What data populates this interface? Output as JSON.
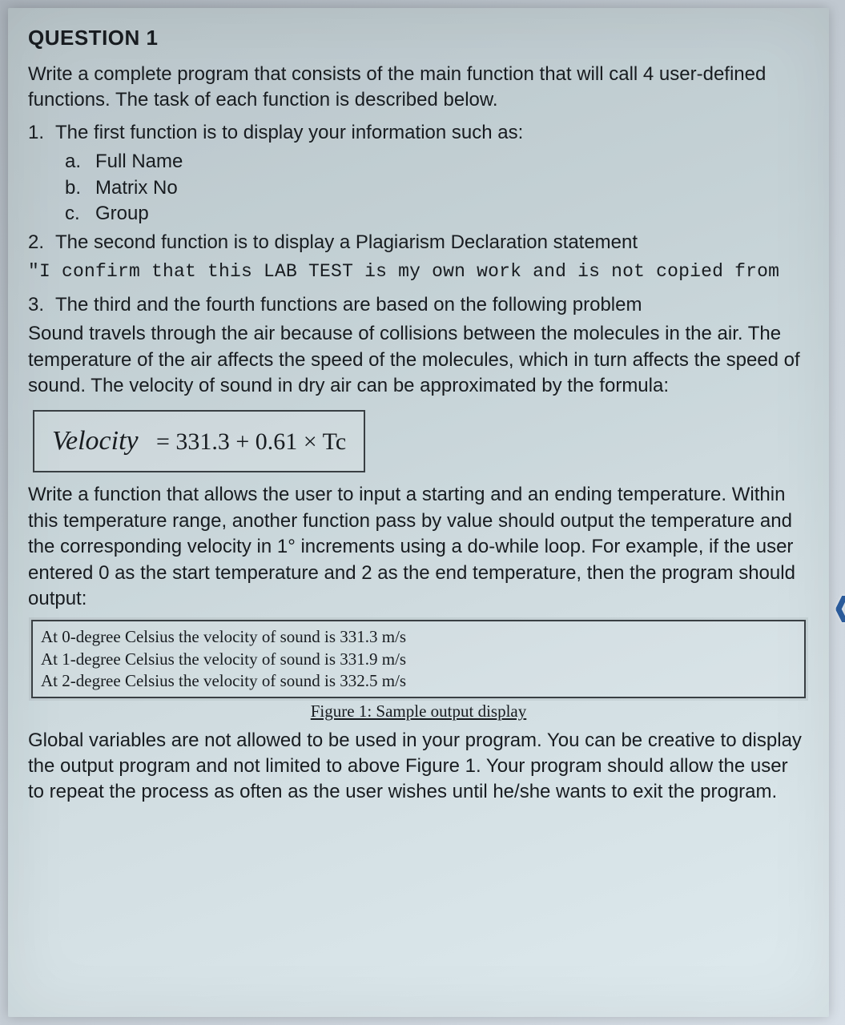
{
  "title": "QUESTION 1",
  "intro": "Write a complete program that consists of the main function that will call 4 user-defined functions. The task of each function is described below.",
  "item1": {
    "num": "1.",
    "text": "The first function is to display your information such as:",
    "a": {
      "label": "a.",
      "text": "Full Name"
    },
    "b": {
      "label": "b.",
      "text": "Matrix No"
    },
    "c": {
      "label": "c.",
      "text": "Group"
    }
  },
  "item2": {
    "num": "2.",
    "text": "The second function is to display a Plagiarism Declaration statement",
    "mono": "\"I confirm that this LAB TEST is my own work and is not copied from"
  },
  "item3": {
    "num": "3.",
    "text": "The third and the fourth functions are based on the following problem"
  },
  "problem": "Sound travels through the air because of collisions between the molecules in the air. The temperature of the air affects the speed of the molecules, which in turn affects the speed of sound. The velocity of sound in dry air can be approximated by the formula:",
  "formula": {
    "lhs": "Velocity",
    "rhs": "=  331.3 + 0.61 × Tc"
  },
  "task": "Write a function that allows the user to input a starting and an ending temperature. Within this temperature range, another function pass by value should output the temperature and the corresponding velocity in 1° increments using a do-while loop. For example, if the user entered 0 as the start temperature and 2 as the end temperature, then the program should output:",
  "output": {
    "l1": "At 0-degree Celsius the velocity of sound is 331.3 m/s",
    "l2": "At 1-degree Celsius the velocity of sound is 331.9 m/s",
    "l3": "At 2-degree Celsius the velocity of sound is 332.5 m/s"
  },
  "figure_caption": "Figure 1: Sample output display",
  "closing": "Global variables are not allowed to be used in your program. You can be creative to display the output program and not limited to above Figure 1. Your program should allow the user to repeat the process as often as the user wishes until he/she wants to exit the program.",
  "chevron": "‹"
}
